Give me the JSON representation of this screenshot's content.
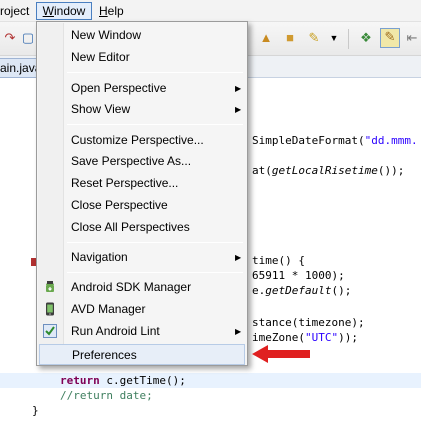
{
  "menubar": {
    "project_label": "roject",
    "window_label": "Window",
    "window_mnemonic": "W",
    "window_rest": "indow",
    "help_label": "Help",
    "help_mnemonic": "H",
    "help_rest": "elp"
  },
  "editor": {
    "tab_label": "ain.java",
    "lines": {
      "l1_pre": "SimpleDateFormat(",
      "l1_str": "\"dd.mmm.",
      "l2_pre": "at(",
      "l2_it": "getLocalRisetime",
      "l2_post": "());",
      "l3": "time() {",
      "l4": "65911 * 1000);",
      "l5_pre": "e.",
      "l5_it": "getDefault",
      "l5_post": "();",
      "l6": "stance(timezone);",
      "l7_pre": "imeZone(",
      "l7_str": "\"UTC\"",
      "l7_post": "));",
      "ret_kw": "return",
      "ret_rest": " c.getTime();",
      "comment": "//return date;",
      "brace": "}"
    }
  },
  "window_menu": {
    "items": [
      {
        "label": "New Window"
      },
      {
        "label": "New Editor"
      },
      {
        "label": "Open Perspective"
      },
      {
        "label": "Show View"
      },
      {
        "label": "Customize Perspective..."
      },
      {
        "label": "Save Perspective As..."
      },
      {
        "label": "Reset Perspective..."
      },
      {
        "label": "Close Perspective"
      },
      {
        "label": "Close All Perspectives"
      },
      {
        "label": "Navigation"
      },
      {
        "label": "Android SDK Manager",
        "icon": "android-sdk-icon"
      },
      {
        "label": "AVD Manager",
        "icon": "avd-device-icon"
      },
      {
        "label": "Run Android Lint",
        "icon": "lint-check-icon"
      },
      {
        "label": "Preferences"
      }
    ]
  },
  "colors": {
    "annotation_arrow": "#e02020",
    "menu_background": "#f5f5f5",
    "hover_highlight": "#e7eef8"
  }
}
